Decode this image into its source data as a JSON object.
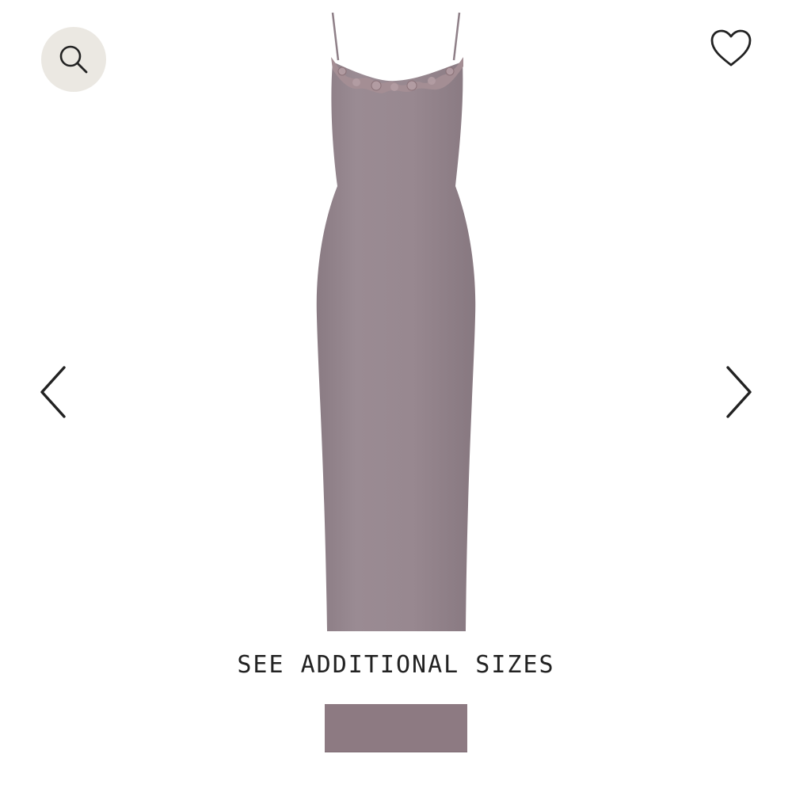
{
  "zoom": {
    "icon": "search-icon",
    "background": "#ebe8e2"
  },
  "wishlist": {
    "icon": "heart-outline-icon"
  },
  "carousel": {
    "prev_icon": "chevron-left-icon",
    "next_icon": "chevron-right-icon"
  },
  "product": {
    "image_type": "slip-dress-with-lace-trim",
    "color": "#968890"
  },
  "sizes_link": {
    "label": "SEE ADDITIONAL SIZES"
  }
}
